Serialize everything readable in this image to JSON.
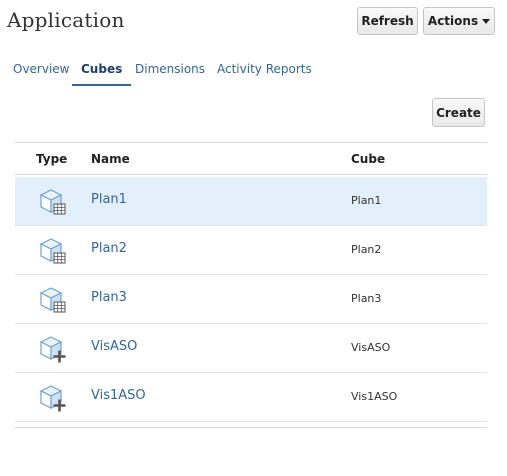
{
  "app": {
    "title": "Application"
  },
  "header_buttons": {
    "refresh_label": "Refresh",
    "actions_label": "Actions"
  },
  "tabs": [
    {
      "label": "Overview",
      "active": false
    },
    {
      "label": "Cubes",
      "active": true
    },
    {
      "label": "Dimensions",
      "active": false
    },
    {
      "label": "Activity Reports",
      "active": false
    }
  ],
  "toolbar": {
    "create_label": "Create"
  },
  "table": {
    "columns": {
      "type": "Type",
      "name": "Name",
      "cube": "Cube"
    },
    "rows": [
      {
        "icon": "bso-cube-icon",
        "name": "Plan1",
        "cube": "Plan1",
        "selected": true
      },
      {
        "icon": "bso-cube-icon",
        "name": "Plan2",
        "cube": "Plan2",
        "selected": false
      },
      {
        "icon": "bso-cube-icon",
        "name": "Plan3",
        "cube": "Plan3",
        "selected": false
      },
      {
        "icon": "aso-cube-icon",
        "name": "VisASO",
        "cube": "VisASO",
        "selected": false
      },
      {
        "icon": "aso-cube-icon",
        "name": "Vis1ASO",
        "cube": "Vis1ASO",
        "selected": false
      }
    ]
  },
  "colors": {
    "link": "#336699",
    "selected_row": "#e3effb",
    "cube_icon": "#6fa3cf"
  }
}
